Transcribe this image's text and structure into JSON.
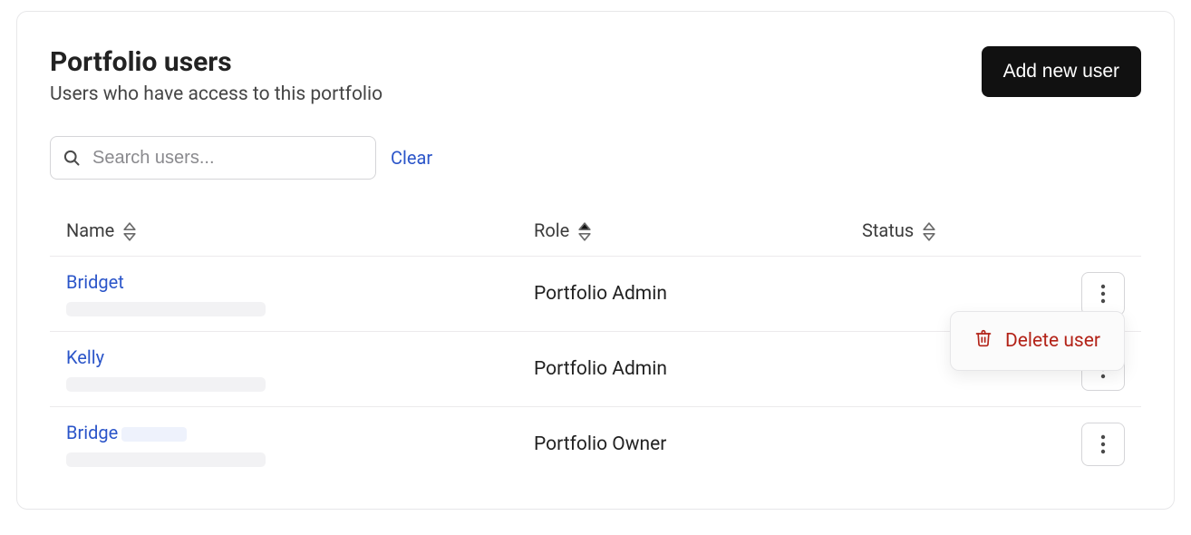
{
  "header": {
    "title": "Portfolio users",
    "subtitle": "Users who have access to this portfolio",
    "add_button": "Add new user"
  },
  "search": {
    "placeholder": "Search users...",
    "clear_label": "Clear"
  },
  "columns": {
    "name": "Name",
    "role": "Role",
    "status": "Status"
  },
  "rows": [
    {
      "name": "Bridget",
      "name_has_inline_redact": false,
      "role": "Portfolio Admin",
      "status": "",
      "menu_open": true
    },
    {
      "name": "Kelly",
      "name_has_inline_redact": false,
      "role": "Portfolio Admin",
      "status": "",
      "menu_open": false
    },
    {
      "name": "Bridge",
      "name_has_inline_redact": true,
      "role": "Portfolio Owner",
      "status": "",
      "menu_open": false
    }
  ],
  "menu": {
    "delete_label": "Delete user"
  },
  "colors": {
    "link": "#2b55c9",
    "danger": "#b32318",
    "button_bg": "#111111"
  }
}
